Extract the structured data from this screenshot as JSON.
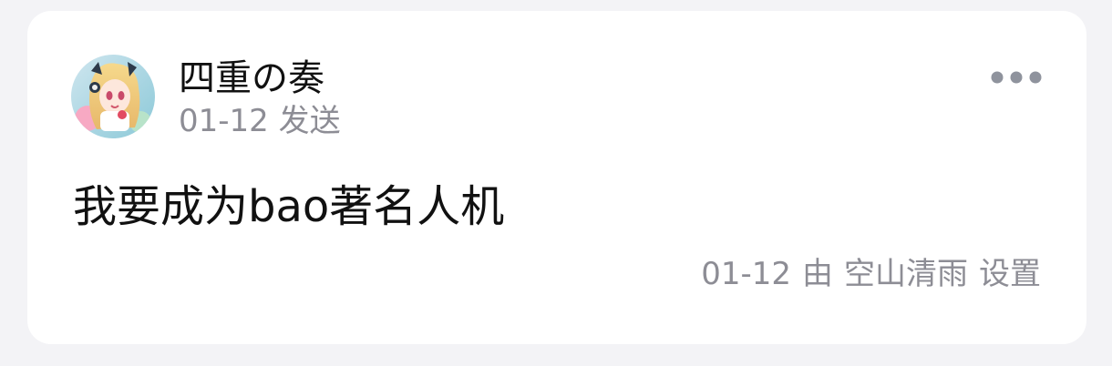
{
  "post": {
    "author": "四重の奏",
    "time": "01-12 发送",
    "content": "我要成为bao著名人机",
    "avatar_icon": "anime-girl-avatar",
    "more_icon": "more-dots-icon"
  },
  "footer": {
    "set_date": "01-12",
    "by_label": "由",
    "setter": "空山清雨",
    "action": "设置"
  }
}
